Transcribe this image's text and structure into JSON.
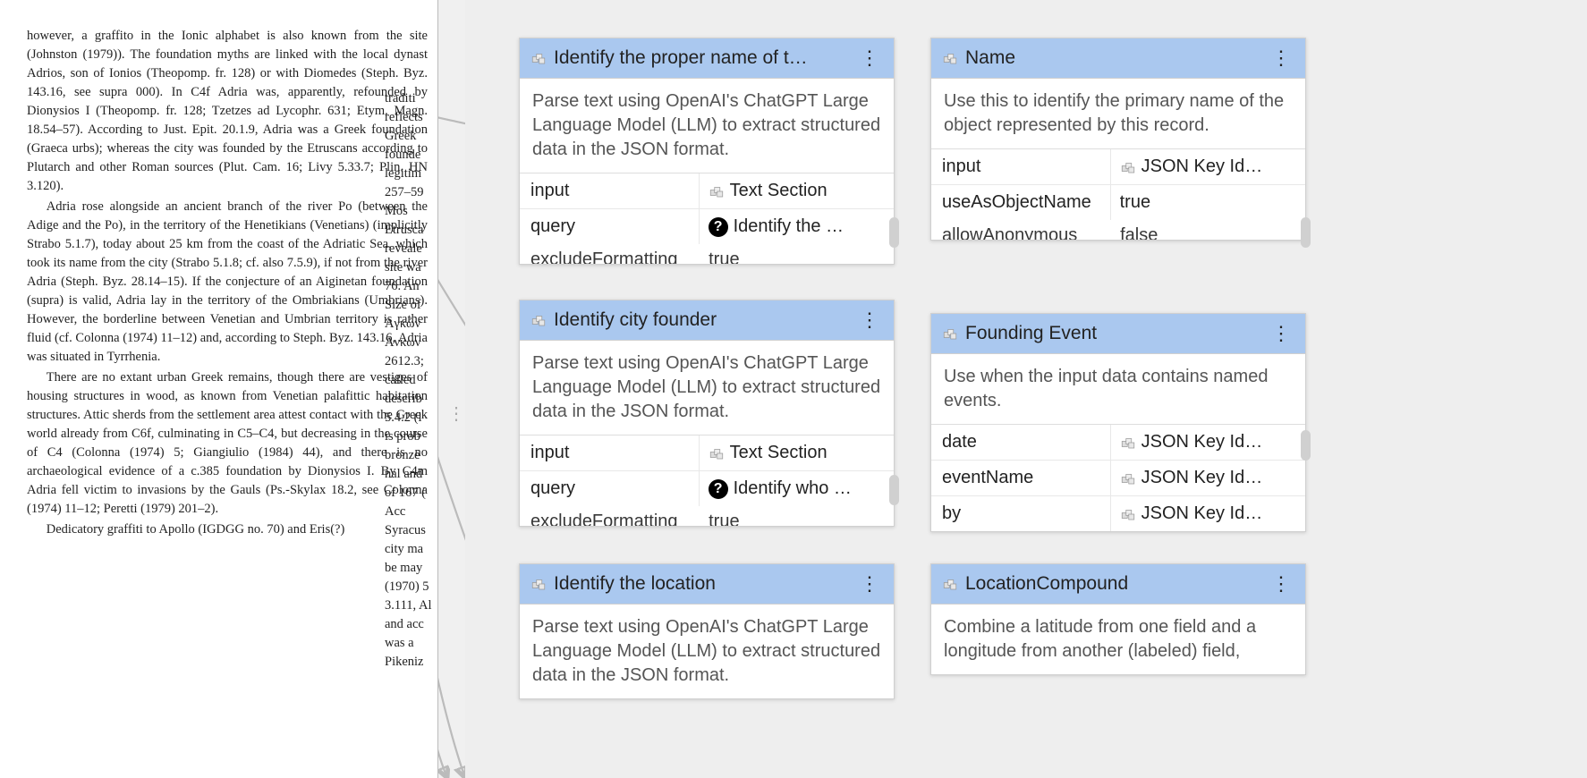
{
  "document": {
    "col1_paragraphs": [
      "however, a graffito in the Ionic alphabet is also known from the site (Johnston (1979)). The foundation myths are linked with the local dynast Adrios, son of Ionios (Theopomp. fr. 128) or with Diomedes (Steph. Byz. 143.16, see supra 000). In C4f Adria was, apparently, refounded by Dionysios I (Theopomp. fr. 128; Tzetzes ad Lycophr. 631; Etym. Magn. 18.54–57). According to Just. Epit. 20.1.9, Adria was a Greek foundation (Graeca urbs); whereas the city was founded by the Etruscans according to Plutarch and other Roman sources (Plut. Cam. 16; Livy 5.33.7; Plin. HN 3.120).",
      "Adria rose alongside an ancient branch of the river Po (between the Adige and the Po), in the territory of the Henetikians (Venetians) (implicitly Strabo 5.1.7), today about 25 km from the coast of the Adriatic Sea, which took its name from the city (Strabo 5.1.8; cf. also 7.5.9), if not from the river Adria (Steph. Byz. 28.14–15). If the conjecture of an Aiginetan foundation (supra) is valid, Adria lay in the territory of the Ombriakians (Umbrians). However, the borderline between Venetian and Umbrian territory is rather fluid (cf. Colonna (1974) 11–12) and, according to Steph. Byz. 143.16, Adria was situated in Tyrrhenia.",
      "There are no extant urban Greek remains, though there are vestiges of housing structures in wood, as known from Venetian palafittic habitation structures. Attic sherds from the settlement area attest contact with the Greek world already from C6f, culminating in C5–C4, but decreasing in the course of C4 (Colonna (1974) 5; Giangiulio (1984) 44), and there is no archaeological evidence of a c.385 foundation by Dionysios I. By C4m Adria fell victim to invasions by the Gauls (Ps.-Skylax 18.2, see Colonna (1974) 11–12; Peretti (1979) 201–2).",
      "Dedicatory graffiti to Apollo (IGDGG no. 70) and Eris(?)"
    ],
    "col2_fragments": [
      "traditi",
      "reflects",
      "Greek",
      "founde",
      "legitim",
      "257–59",
      "Mos",
      "Etrusca",
      "reveale",
      "site wa",
      "",
      "76. An",
      "Size of",
      "Ἀγκών",
      "Ἀνκων",
      "2612.3;",
      "called",
      "describ",
      "5.4.2 (l",
      "is prob",
      "bronze",
      "nal and",
      "of 167 (",
      "Acc",
      "Syracus",
      "city ma",
      "be may",
      "(1970) 5",
      "3.111, Al",
      "and acc",
      "was a",
      "Pikeniz"
    ]
  },
  "nodes": {
    "n1": {
      "title": "Identify the proper name of t…",
      "desc": "Parse text using OpenAI's ChatGPT Large Language Model (LLM) to extract structured data in the JSON format.",
      "params": [
        {
          "key": "input",
          "val": "Text Section",
          "icon": "block"
        },
        {
          "key": "query",
          "val": "Identify the …",
          "icon": "help"
        }
      ],
      "fade": {
        "k": "excludeFormatting",
        "v": "true"
      }
    },
    "n2": {
      "title": "Name",
      "desc": "Use this to identify the primary name of the object represented by this record.",
      "params": [
        {
          "key": "input",
          "val": "JSON Key Id…",
          "icon": "block"
        },
        {
          "key": "useAsObjectName",
          "val": "true",
          "icon": "none"
        }
      ],
      "fade": {
        "k": "allowAnonymous",
        "v": "false"
      }
    },
    "n3": {
      "title": "Identify city founder",
      "desc": "Parse text using OpenAI's ChatGPT Large Language Model (LLM) to extract structured data in the JSON format.",
      "params": [
        {
          "key": "input",
          "val": "Text Section",
          "icon": "block"
        },
        {
          "key": "query",
          "val": "Identify who …",
          "icon": "help"
        }
      ],
      "fade": {
        "k": "excludeFormatting",
        "v": "true"
      }
    },
    "n4": {
      "title": "Founding Event",
      "desc": "Use when the input data contains named events.",
      "params": [
        {
          "key": "date",
          "val": "JSON Key Id…",
          "icon": "block"
        },
        {
          "key": "eventName",
          "val": "JSON Key Id…",
          "icon": "block"
        },
        {
          "key": "by",
          "val": "JSON Key Id…",
          "icon": "block"
        }
      ],
      "fade": {
        "k": "",
        "v": ""
      }
    },
    "n5": {
      "title": "Identify the location",
      "desc": "Parse text using OpenAI's ChatGPT Large Language Model (LLM) to extract structured data in the JSON format.",
      "params": [],
      "fade": null
    },
    "n6": {
      "title": "LocationCompound",
      "desc": "Combine a latitude from one field and a longitude from another (labeled) field,",
      "params": [],
      "fade": null
    }
  }
}
